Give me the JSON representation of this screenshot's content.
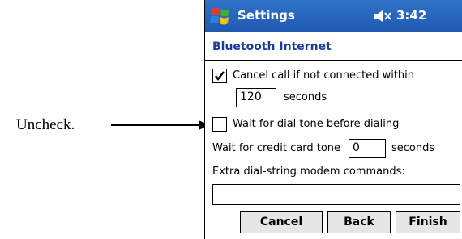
{
  "annotation": {
    "callout_text": "Uncheck."
  },
  "titlebar": {
    "app_title": "Settings",
    "time": "3:42",
    "volume_icon": "speaker-icon"
  },
  "page": {
    "subtitle": "Bluetooth Internet"
  },
  "form": {
    "cancel_call": {
      "label": "Cancel call if not connected within",
      "checked": true
    },
    "timeout": {
      "value": "120",
      "unit": "seconds"
    },
    "dial_tone": {
      "label": "Wait for dial tone before dialing",
      "checked": false
    },
    "credit_card": {
      "label": "Wait for credit card tone",
      "value": "0",
      "unit": "seconds"
    },
    "extra_commands": {
      "label": "Extra dial-string modem commands:",
      "value": ""
    }
  },
  "buttons": {
    "cancel": "Cancel",
    "back": "Back",
    "finish": "Finish"
  },
  "colors": {
    "titlebar": "#2159b0",
    "subtitle": "#1d3c9e"
  }
}
